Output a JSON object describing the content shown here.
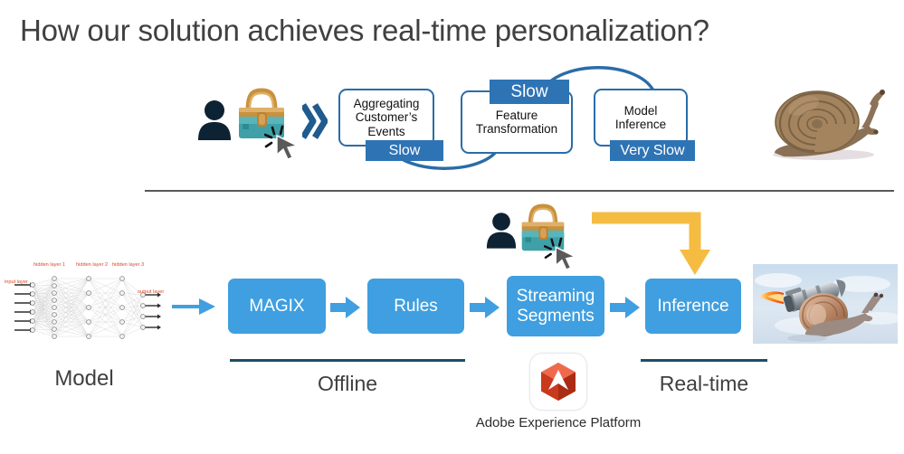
{
  "slide": {
    "title": "How our solution achieves real-time personalization?"
  },
  "colors": {
    "title_text": "#404040",
    "outline_box_border": "#2a6ca8",
    "badge_blue": "#2e74b5",
    "pipeline_blue": "#3f9fe0",
    "underline_blue": "#1f4e67",
    "divider_gray": "#595959",
    "yellow_arrow": "#f5bc42",
    "nn_label_red": "#d64a2a",
    "adobe_red": "#e8402a"
  },
  "legacy_flow": {
    "customer": {
      "person_icon": "person-icon",
      "bag_icon": "shopping-bag-icon",
      "cursor_icon": "click-cursor-icon",
      "chevron_icon": "double-chevron-right-icon"
    },
    "steps": [
      {
        "label": "Aggregating Customer’s Events",
        "badge": "Slow",
        "badge_position": "bottom"
      },
      {
        "label": "Feature Transformation",
        "badge": "Slow",
        "badge_position": "top"
      },
      {
        "label": "Model Inference",
        "badge": "Very Slow",
        "badge_position": "bottom"
      }
    ],
    "end_icon": "snail-icon"
  },
  "model": {
    "caption": "Model",
    "diagram_icon": "neural-network-icon",
    "layer_labels": {
      "input": "input layer",
      "hidden1": "hidden layer 1",
      "hidden2": "hidden layer 2",
      "hidden3": "hidden layer 3",
      "output": "output layer"
    },
    "arrow_icon": "arrow-right-icon"
  },
  "solution_flow": {
    "customer": {
      "person_icon": "person-icon",
      "bag_icon": "shopping-bag-icon",
      "cursor_icon": "click-cursor-icon"
    },
    "routing_arrow_icon": "yellow-elbow-arrow-icon",
    "steps": [
      {
        "label": "MAGIX"
      },
      {
        "label": "Rules"
      },
      {
        "label": "Streaming Segments"
      },
      {
        "label": "Inference"
      }
    ],
    "step_arrow_icon": "fat-arrow-right-icon",
    "end_icon": "rocket-snail-icon"
  },
  "phases": {
    "offline": "Offline",
    "realtime": "Real-time"
  },
  "platform": {
    "logo_icon": "adobe-experience-platform-logo",
    "caption": "Adobe Experience Platform"
  }
}
